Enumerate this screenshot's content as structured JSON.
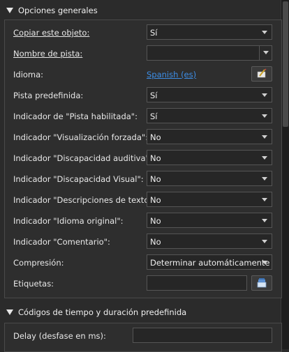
{
  "section1": {
    "title": "Opciones generales",
    "rows": [
      {
        "label": "Copiar este objeto:",
        "value": "Sí"
      },
      {
        "label": "Nombre de pista:",
        "value": ""
      },
      {
        "label": "Idioma:",
        "value": "Spanish (es)"
      },
      {
        "label": "Pista predefinida:",
        "value": "Sí"
      },
      {
        "label": "Indicador de \"Pista habilitada\":",
        "value": "Sí"
      },
      {
        "label": "Indicador \"Visualización forzada\":",
        "value": "No"
      },
      {
        "label": "Indicador \"Discapacidad auditiva\":",
        "value": "No"
      },
      {
        "label": "Indicador \"Discapacidad Visual\":",
        "value": "No"
      },
      {
        "label": "Indicador \"Descripciones de texto\":",
        "value": "No"
      },
      {
        "label": "Indicador \"Idioma original\":",
        "value": "No"
      },
      {
        "label": "Indicador \"Comentario\":",
        "value": "No"
      },
      {
        "label": "Compresión:",
        "value": "Determinar automáticamente"
      },
      {
        "label": "Etiquetas:",
        "value": ""
      }
    ]
  },
  "section2": {
    "title": "Códigos de tiempo y duración predefinida",
    "rows": [
      {
        "label": "Delay (desfase en ms):",
        "value": ""
      }
    ]
  },
  "icons": {
    "language_edit": "edit-language-icon",
    "tags_browse": "tags-browse-icon"
  },
  "colors": {
    "link": "#3d8ee6",
    "background": "#2b2b2b"
  }
}
